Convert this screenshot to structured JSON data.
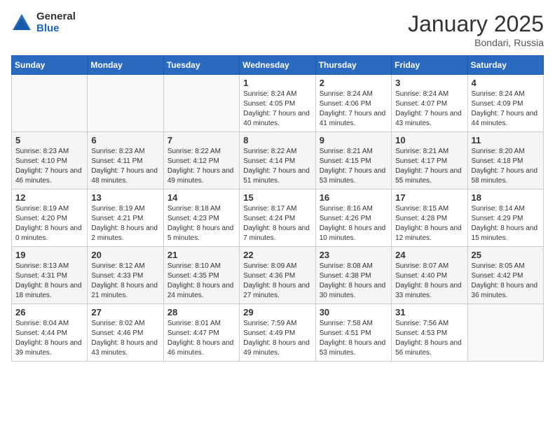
{
  "logo": {
    "general": "General",
    "blue": "Blue"
  },
  "title": "January 2025",
  "location": "Bondari, Russia",
  "days_header": [
    "Sunday",
    "Monday",
    "Tuesday",
    "Wednesday",
    "Thursday",
    "Friday",
    "Saturday"
  ],
  "weeks": [
    [
      {
        "day": "",
        "sunrise": "",
        "sunset": "",
        "daylight": ""
      },
      {
        "day": "",
        "sunrise": "",
        "sunset": "",
        "daylight": ""
      },
      {
        "day": "",
        "sunrise": "",
        "sunset": "",
        "daylight": ""
      },
      {
        "day": "1",
        "sunrise": "Sunrise: 8:24 AM",
        "sunset": "Sunset: 4:05 PM",
        "daylight": "Daylight: 7 hours and 40 minutes."
      },
      {
        "day": "2",
        "sunrise": "Sunrise: 8:24 AM",
        "sunset": "Sunset: 4:06 PM",
        "daylight": "Daylight: 7 hours and 41 minutes."
      },
      {
        "day": "3",
        "sunrise": "Sunrise: 8:24 AM",
        "sunset": "Sunset: 4:07 PM",
        "daylight": "Daylight: 7 hours and 43 minutes."
      },
      {
        "day": "4",
        "sunrise": "Sunrise: 8:24 AM",
        "sunset": "Sunset: 4:09 PM",
        "daylight": "Daylight: 7 hours and 44 minutes."
      }
    ],
    [
      {
        "day": "5",
        "sunrise": "Sunrise: 8:23 AM",
        "sunset": "Sunset: 4:10 PM",
        "daylight": "Daylight: 7 hours and 46 minutes."
      },
      {
        "day": "6",
        "sunrise": "Sunrise: 8:23 AM",
        "sunset": "Sunset: 4:11 PM",
        "daylight": "Daylight: 7 hours and 48 minutes."
      },
      {
        "day": "7",
        "sunrise": "Sunrise: 8:22 AM",
        "sunset": "Sunset: 4:12 PM",
        "daylight": "Daylight: 7 hours and 49 minutes."
      },
      {
        "day": "8",
        "sunrise": "Sunrise: 8:22 AM",
        "sunset": "Sunset: 4:14 PM",
        "daylight": "Daylight: 7 hours and 51 minutes."
      },
      {
        "day": "9",
        "sunrise": "Sunrise: 8:21 AM",
        "sunset": "Sunset: 4:15 PM",
        "daylight": "Daylight: 7 hours and 53 minutes."
      },
      {
        "day": "10",
        "sunrise": "Sunrise: 8:21 AM",
        "sunset": "Sunset: 4:17 PM",
        "daylight": "Daylight: 7 hours and 55 minutes."
      },
      {
        "day": "11",
        "sunrise": "Sunrise: 8:20 AM",
        "sunset": "Sunset: 4:18 PM",
        "daylight": "Daylight: 7 hours and 58 minutes."
      }
    ],
    [
      {
        "day": "12",
        "sunrise": "Sunrise: 8:19 AM",
        "sunset": "Sunset: 4:20 PM",
        "daylight": "Daylight: 8 hours and 0 minutes."
      },
      {
        "day": "13",
        "sunrise": "Sunrise: 8:19 AM",
        "sunset": "Sunset: 4:21 PM",
        "daylight": "Daylight: 8 hours and 2 minutes."
      },
      {
        "day": "14",
        "sunrise": "Sunrise: 8:18 AM",
        "sunset": "Sunset: 4:23 PM",
        "daylight": "Daylight: 8 hours and 5 minutes."
      },
      {
        "day": "15",
        "sunrise": "Sunrise: 8:17 AM",
        "sunset": "Sunset: 4:24 PM",
        "daylight": "Daylight: 8 hours and 7 minutes."
      },
      {
        "day": "16",
        "sunrise": "Sunrise: 8:16 AM",
        "sunset": "Sunset: 4:26 PM",
        "daylight": "Daylight: 8 hours and 10 minutes."
      },
      {
        "day": "17",
        "sunrise": "Sunrise: 8:15 AM",
        "sunset": "Sunset: 4:28 PM",
        "daylight": "Daylight: 8 hours and 12 minutes."
      },
      {
        "day": "18",
        "sunrise": "Sunrise: 8:14 AM",
        "sunset": "Sunset: 4:29 PM",
        "daylight": "Daylight: 8 hours and 15 minutes."
      }
    ],
    [
      {
        "day": "19",
        "sunrise": "Sunrise: 8:13 AM",
        "sunset": "Sunset: 4:31 PM",
        "daylight": "Daylight: 8 hours and 18 minutes."
      },
      {
        "day": "20",
        "sunrise": "Sunrise: 8:12 AM",
        "sunset": "Sunset: 4:33 PM",
        "daylight": "Daylight: 8 hours and 21 minutes."
      },
      {
        "day": "21",
        "sunrise": "Sunrise: 8:10 AM",
        "sunset": "Sunset: 4:35 PM",
        "daylight": "Daylight: 8 hours and 24 minutes."
      },
      {
        "day": "22",
        "sunrise": "Sunrise: 8:09 AM",
        "sunset": "Sunset: 4:36 PM",
        "daylight": "Daylight: 8 hours and 27 minutes."
      },
      {
        "day": "23",
        "sunrise": "Sunrise: 8:08 AM",
        "sunset": "Sunset: 4:38 PM",
        "daylight": "Daylight: 8 hours and 30 minutes."
      },
      {
        "day": "24",
        "sunrise": "Sunrise: 8:07 AM",
        "sunset": "Sunset: 4:40 PM",
        "daylight": "Daylight: 8 hours and 33 minutes."
      },
      {
        "day": "25",
        "sunrise": "Sunrise: 8:05 AM",
        "sunset": "Sunset: 4:42 PM",
        "daylight": "Daylight: 8 hours and 36 minutes."
      }
    ],
    [
      {
        "day": "26",
        "sunrise": "Sunrise: 8:04 AM",
        "sunset": "Sunset: 4:44 PM",
        "daylight": "Daylight: 8 hours and 39 minutes."
      },
      {
        "day": "27",
        "sunrise": "Sunrise: 8:02 AM",
        "sunset": "Sunset: 4:46 PM",
        "daylight": "Daylight: 8 hours and 43 minutes."
      },
      {
        "day": "28",
        "sunrise": "Sunrise: 8:01 AM",
        "sunset": "Sunset: 4:47 PM",
        "daylight": "Daylight: 8 hours and 46 minutes."
      },
      {
        "day": "29",
        "sunrise": "Sunrise: 7:59 AM",
        "sunset": "Sunset: 4:49 PM",
        "daylight": "Daylight: 8 hours and 49 minutes."
      },
      {
        "day": "30",
        "sunrise": "Sunrise: 7:58 AM",
        "sunset": "Sunset: 4:51 PM",
        "daylight": "Daylight: 8 hours and 53 minutes."
      },
      {
        "day": "31",
        "sunrise": "Sunrise: 7:56 AM",
        "sunset": "Sunset: 4:53 PM",
        "daylight": "Daylight: 8 hours and 56 minutes."
      },
      {
        "day": "",
        "sunrise": "",
        "sunset": "",
        "daylight": ""
      }
    ]
  ]
}
